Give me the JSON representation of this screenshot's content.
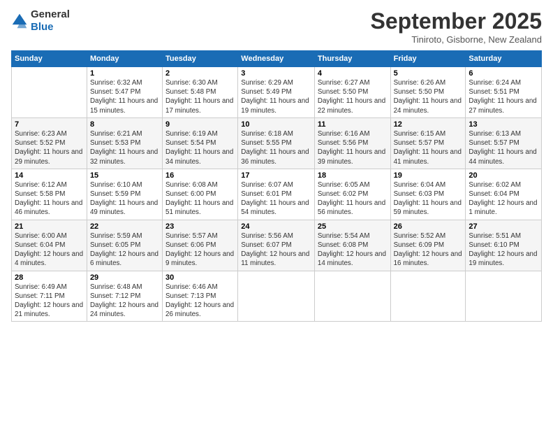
{
  "header": {
    "logo_line1": "General",
    "logo_line2": "Blue",
    "month": "September 2025",
    "location": "Tiniroto, Gisborne, New Zealand"
  },
  "days_of_week": [
    "Sunday",
    "Monday",
    "Tuesday",
    "Wednesday",
    "Thursday",
    "Friday",
    "Saturday"
  ],
  "weeks": [
    [
      {
        "day": "",
        "info": ""
      },
      {
        "day": "1",
        "info": "Sunrise: 6:32 AM\nSunset: 5:47 PM\nDaylight: 11 hours\nand 15 minutes."
      },
      {
        "day": "2",
        "info": "Sunrise: 6:30 AM\nSunset: 5:48 PM\nDaylight: 11 hours\nand 17 minutes."
      },
      {
        "day": "3",
        "info": "Sunrise: 6:29 AM\nSunset: 5:49 PM\nDaylight: 11 hours\nand 19 minutes."
      },
      {
        "day": "4",
        "info": "Sunrise: 6:27 AM\nSunset: 5:50 PM\nDaylight: 11 hours\nand 22 minutes."
      },
      {
        "day": "5",
        "info": "Sunrise: 6:26 AM\nSunset: 5:50 PM\nDaylight: 11 hours\nand 24 minutes."
      },
      {
        "day": "6",
        "info": "Sunrise: 6:24 AM\nSunset: 5:51 PM\nDaylight: 11 hours\nand 27 minutes."
      }
    ],
    [
      {
        "day": "7",
        "info": "Sunrise: 6:23 AM\nSunset: 5:52 PM\nDaylight: 11 hours\nand 29 minutes."
      },
      {
        "day": "8",
        "info": "Sunrise: 6:21 AM\nSunset: 5:53 PM\nDaylight: 11 hours\nand 32 minutes."
      },
      {
        "day": "9",
        "info": "Sunrise: 6:19 AM\nSunset: 5:54 PM\nDaylight: 11 hours\nand 34 minutes."
      },
      {
        "day": "10",
        "info": "Sunrise: 6:18 AM\nSunset: 5:55 PM\nDaylight: 11 hours\nand 36 minutes."
      },
      {
        "day": "11",
        "info": "Sunrise: 6:16 AM\nSunset: 5:56 PM\nDaylight: 11 hours\nand 39 minutes."
      },
      {
        "day": "12",
        "info": "Sunrise: 6:15 AM\nSunset: 5:57 PM\nDaylight: 11 hours\nand 41 minutes."
      },
      {
        "day": "13",
        "info": "Sunrise: 6:13 AM\nSunset: 5:57 PM\nDaylight: 11 hours\nand 44 minutes."
      }
    ],
    [
      {
        "day": "14",
        "info": "Sunrise: 6:12 AM\nSunset: 5:58 PM\nDaylight: 11 hours\nand 46 minutes."
      },
      {
        "day": "15",
        "info": "Sunrise: 6:10 AM\nSunset: 5:59 PM\nDaylight: 11 hours\nand 49 minutes."
      },
      {
        "day": "16",
        "info": "Sunrise: 6:08 AM\nSunset: 6:00 PM\nDaylight: 11 hours\nand 51 minutes."
      },
      {
        "day": "17",
        "info": "Sunrise: 6:07 AM\nSunset: 6:01 PM\nDaylight: 11 hours\nand 54 minutes."
      },
      {
        "day": "18",
        "info": "Sunrise: 6:05 AM\nSunset: 6:02 PM\nDaylight: 11 hours\nand 56 minutes."
      },
      {
        "day": "19",
        "info": "Sunrise: 6:04 AM\nSunset: 6:03 PM\nDaylight: 11 hours\nand 59 minutes."
      },
      {
        "day": "20",
        "info": "Sunrise: 6:02 AM\nSunset: 6:04 PM\nDaylight: 12 hours\nand 1 minute."
      }
    ],
    [
      {
        "day": "21",
        "info": "Sunrise: 6:00 AM\nSunset: 6:04 PM\nDaylight: 12 hours\nand 4 minutes."
      },
      {
        "day": "22",
        "info": "Sunrise: 5:59 AM\nSunset: 6:05 PM\nDaylight: 12 hours\nand 6 minutes."
      },
      {
        "day": "23",
        "info": "Sunrise: 5:57 AM\nSunset: 6:06 PM\nDaylight: 12 hours\nand 9 minutes."
      },
      {
        "day": "24",
        "info": "Sunrise: 5:56 AM\nSunset: 6:07 PM\nDaylight: 12 hours\nand 11 minutes."
      },
      {
        "day": "25",
        "info": "Sunrise: 5:54 AM\nSunset: 6:08 PM\nDaylight: 12 hours\nand 14 minutes."
      },
      {
        "day": "26",
        "info": "Sunrise: 5:52 AM\nSunset: 6:09 PM\nDaylight: 12 hours\nand 16 minutes."
      },
      {
        "day": "27",
        "info": "Sunrise: 5:51 AM\nSunset: 6:10 PM\nDaylight: 12 hours\nand 19 minutes."
      }
    ],
    [
      {
        "day": "28",
        "info": "Sunrise: 6:49 AM\nSunset: 7:11 PM\nDaylight: 12 hours\nand 21 minutes."
      },
      {
        "day": "29",
        "info": "Sunrise: 6:48 AM\nSunset: 7:12 PM\nDaylight: 12 hours\nand 24 minutes."
      },
      {
        "day": "30",
        "info": "Sunrise: 6:46 AM\nSunset: 7:13 PM\nDaylight: 12 hours\nand 26 minutes."
      },
      {
        "day": "",
        "info": ""
      },
      {
        "day": "",
        "info": ""
      },
      {
        "day": "",
        "info": ""
      },
      {
        "day": "",
        "info": ""
      }
    ]
  ]
}
